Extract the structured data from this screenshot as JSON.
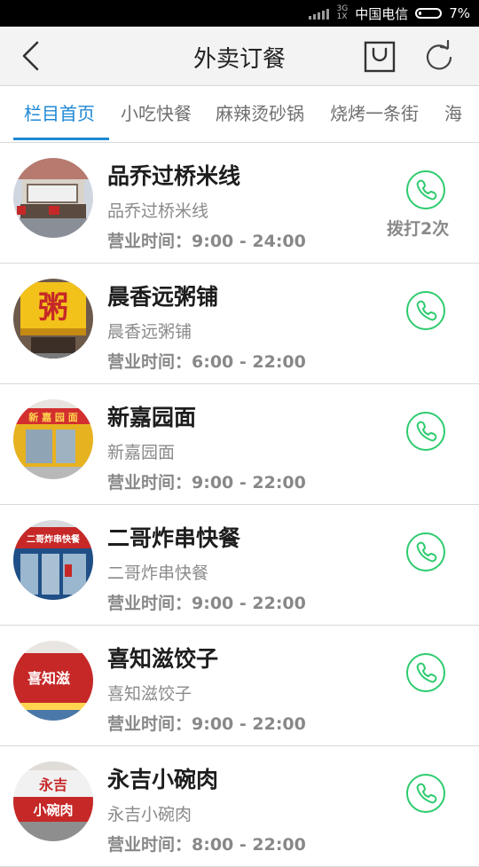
{
  "status_bar": {
    "network_type_top": "3G",
    "network_type_bottom": "1X",
    "carrier": "中国电信",
    "battery": "7%"
  },
  "header": {
    "title": "外卖订餐",
    "icons": [
      "back-icon",
      "cart-icon",
      "refresh-icon"
    ]
  },
  "tabs": [
    {
      "label": "栏目首页",
      "active": true
    },
    {
      "label": "小吃快餐",
      "active": false
    },
    {
      "label": "麻辣烫砂锅",
      "active": false
    },
    {
      "label": "烧烤一条街",
      "active": false
    },
    {
      "label": "海",
      "active": false
    }
  ],
  "restaurants": [
    {
      "name": "品乔过桥米线",
      "subtitle": "品乔过桥米线",
      "hours": "营业时间：9:00  -  24:00",
      "calls": "拨打2次"
    },
    {
      "name": "晨香远粥铺",
      "subtitle": "晨香远粥铺",
      "hours": "营业时间：6:00  -  22:00",
      "calls": ""
    },
    {
      "name": "新嘉园面",
      "subtitle": "新嘉园面",
      "hours": "营业时间：9:00  -  22:00",
      "calls": ""
    },
    {
      "name": "二哥炸串快餐",
      "subtitle": "二哥炸串快餐",
      "hours": "营业时间：9:00  -  22:00",
      "calls": ""
    },
    {
      "name": "喜知滋饺子",
      "subtitle": "喜知滋饺子",
      "hours": "营业时间：9:00  -  22:00",
      "calls": ""
    },
    {
      "name": "永吉小碗肉",
      "subtitle": "永吉小碗肉",
      "hours": "营业时间：8:00  -  22:00",
      "calls": ""
    }
  ],
  "avatar_signs": {
    "r2": "粥",
    "r3": "新 嘉 园 面",
    "r4": "二哥炸串快餐",
    "r5": "喜知滋",
    "r6a": "永吉",
    "r6b": "小碗肉"
  },
  "colors": {
    "accent": "#1e88d6",
    "phone_green": "#2ecb6e"
  }
}
